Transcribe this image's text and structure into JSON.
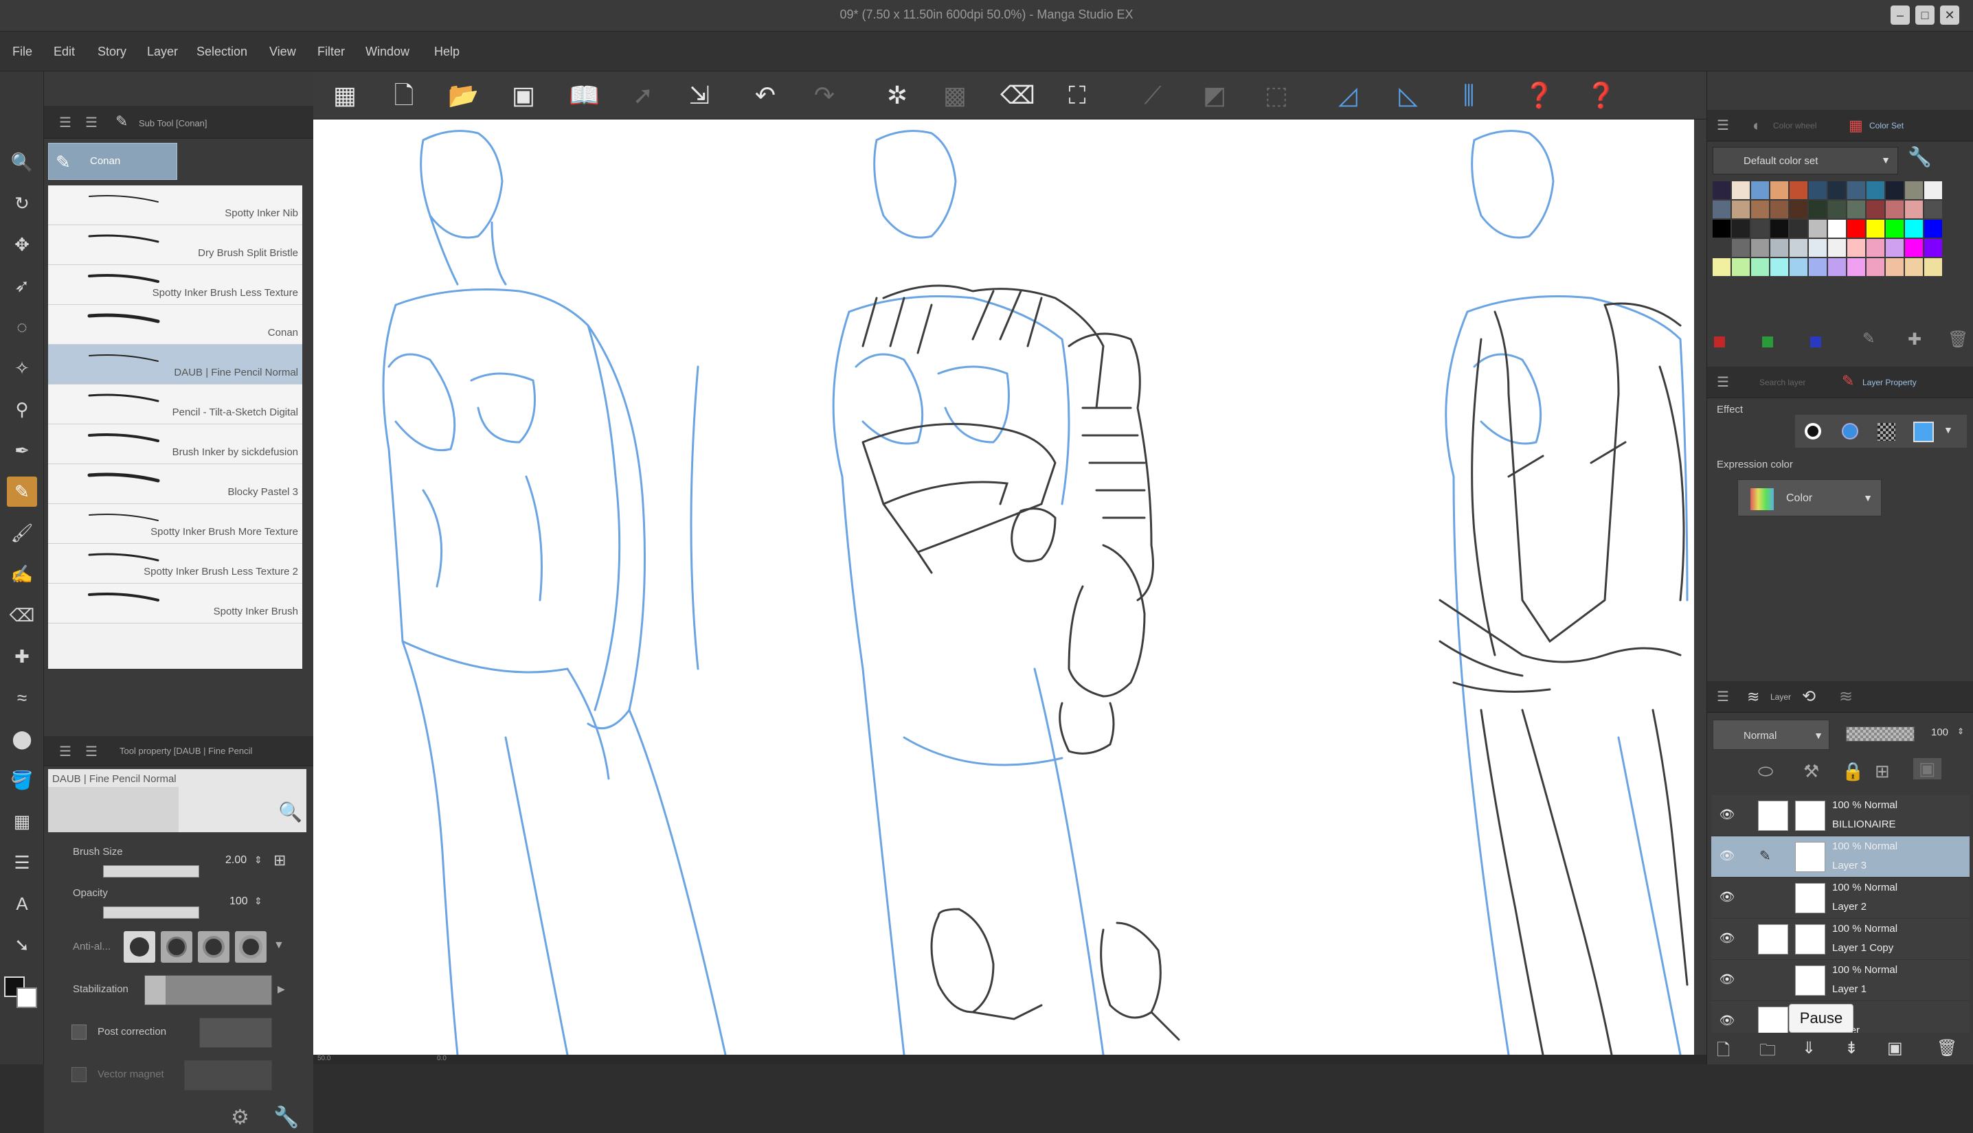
{
  "window": {
    "title": "09* (7.50 x 11.50in 600dpi 50.0%) - Manga Studio EX"
  },
  "menu": [
    "File",
    "Edit",
    "Story",
    "Layer",
    "Selection",
    "View",
    "Filter",
    "Window",
    "Help"
  ],
  "subtool_panel": {
    "tab_label": "Sub Tool [Conan]",
    "selected_group": "Conan",
    "brushes": [
      "Spotty Inker Nib",
      "Dry Brush Split Bristle",
      "Spotty Inker Brush Less Texture",
      "Conan",
      "DAUB | Fine Pencil Normal",
      "Pencil - Tilt-a-Sketch Digital",
      "Brush Inker by sickdefusion",
      "Blocky Pastel 3",
      "Spotty Inker Brush More Texture",
      "Spotty Inker Brush Less Texture 2",
      "Spotty Inker Brush"
    ],
    "selected_index": 4
  },
  "tool_property": {
    "tab_label": "Tool property [DAUB | Fine Pencil",
    "preset_name": "DAUB | Fine Pencil Normal",
    "brush_size_label": "Brush Size",
    "brush_size_value": "2.00",
    "opacity_label": "Opacity",
    "opacity_value": "100",
    "antialias_label": "Anti-al...",
    "stabilization_label": "Stabilization",
    "post_correction_label": "Post correction",
    "vector_magnet_label": "Vector magnet"
  },
  "color_panel": {
    "tab1": "Color wheel",
    "tab2": "Color Set",
    "set_name": "Default color set"
  },
  "layer_property": {
    "tab1": "Search layer",
    "tab2": "Layer Property",
    "effect_label": "Effect",
    "expression_label": "Expression color",
    "expression_value": "Color"
  },
  "layer_panel": {
    "tab": "Layer",
    "blend_mode": "Normal",
    "opacity": "100",
    "layers": [
      {
        "opacity": "100 %  Normal",
        "name": "BILLIONAIRE"
      },
      {
        "opacity": "100 %  Normal",
        "name": "Layer 3"
      },
      {
        "opacity": "100 %  Normal",
        "name": "Layer 2"
      },
      {
        "opacity": "100 %  Normal",
        "name": "Layer 1 Copy"
      },
      {
        "opacity": "100 %  Normal",
        "name": "Layer 1"
      },
      {
        "opacity": "",
        "name": "Paper"
      }
    ]
  },
  "tooltip": "Pause",
  "status": {
    "zoom": "50.0",
    "angle": "0.0"
  },
  "colors": {
    "accent": "#5aa0e6",
    "selected_tool": "#c98d3a",
    "sketch_blue": "#5b9be0"
  }
}
